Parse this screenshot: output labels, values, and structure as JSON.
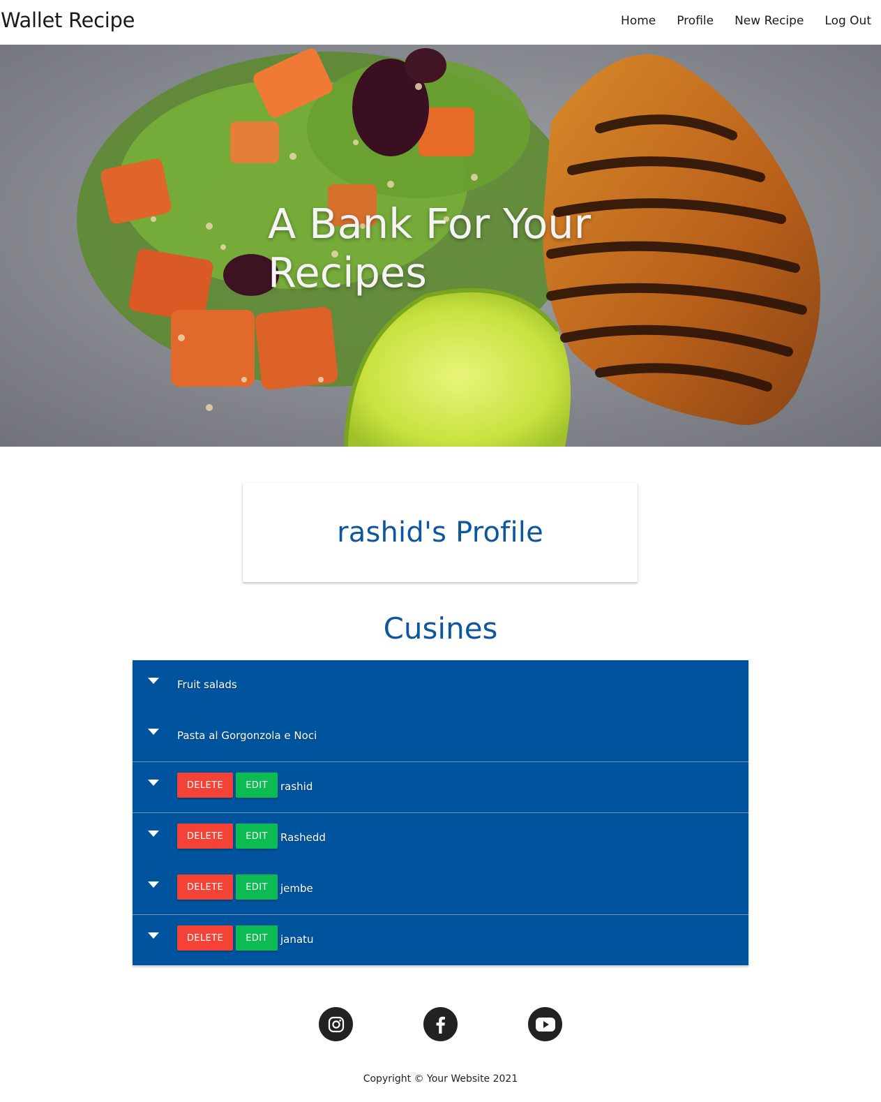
{
  "navbar": {
    "brand": "Wallet Recipe",
    "links": [
      "Home",
      "Profile",
      "New Recipe",
      "Log Out"
    ]
  },
  "hero": {
    "title": "A Bank For Your Recipes"
  },
  "profile": {
    "title": "rashid's Profile"
  },
  "cuisines": {
    "title": "Cusines",
    "items": [
      {
        "label": "Fruit salads",
        "owned": false
      },
      {
        "label": "Pasta al Gorgonzola e Noci",
        "owned": false
      },
      {
        "label": "rashid",
        "owned": true
      },
      {
        "label": "Rashedd",
        "owned": true
      },
      {
        "label": "jembe",
        "owned": true
      },
      {
        "label": "janatu",
        "owned": true
      }
    ],
    "delete_label": "Delete",
    "edit_label": "Edit"
  },
  "footer": {
    "social": [
      "instagram-icon",
      "facebook-icon",
      "youtube-icon"
    ],
    "copyright": "Copyright © Your Website 2021"
  },
  "colors": {
    "accent": "#0d56a0",
    "list_bg": "#00549e",
    "delete": "#f44336",
    "edit": "#0cbb52"
  }
}
